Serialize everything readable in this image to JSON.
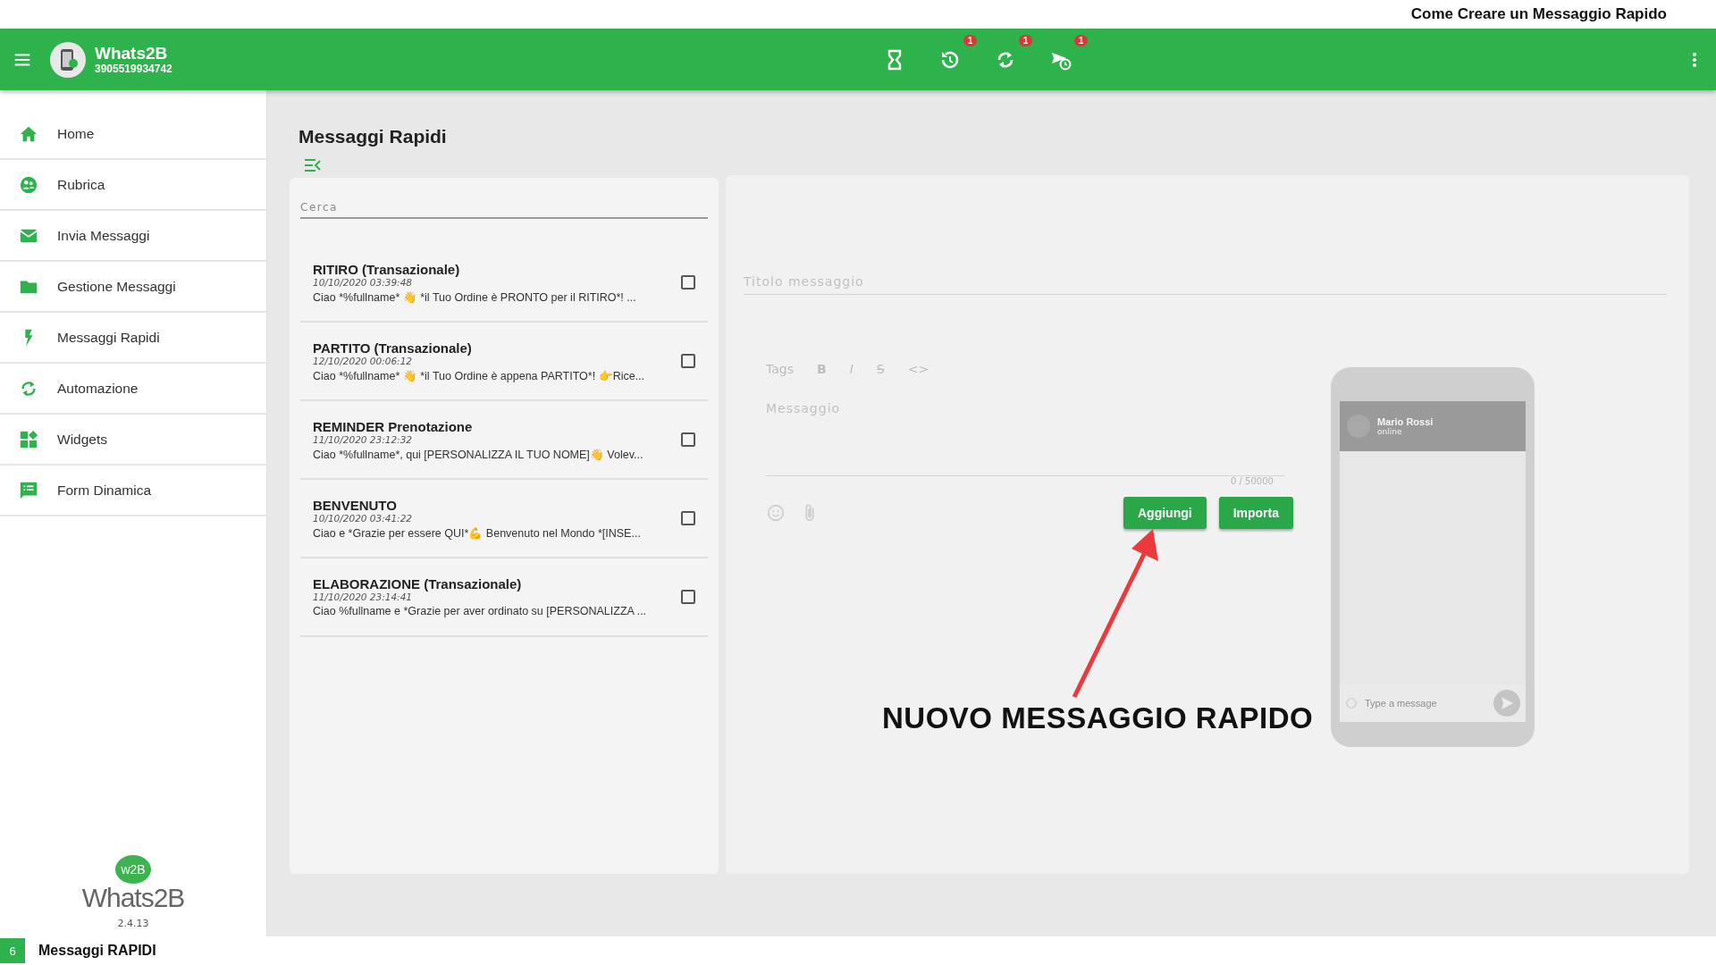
{
  "caption": {
    "title": "Come Creare un Messaggio Rapido"
  },
  "header": {
    "app_name": "Whats2B",
    "phone": "3905519934742",
    "actions": [
      {
        "kind": "hourglass"
      },
      {
        "kind": "history",
        "badge": "1"
      },
      {
        "kind": "sync",
        "badge": "1"
      },
      {
        "kind": "scheduled-send",
        "badge": "1"
      }
    ]
  },
  "sidebar": {
    "items": [
      {
        "label": "Home",
        "kind": "home"
      },
      {
        "label": "Rubrica",
        "kind": "contacts"
      },
      {
        "label": "Invia Messaggi",
        "kind": "mail"
      },
      {
        "label": "Gestione Messaggi",
        "kind": "folder"
      },
      {
        "label": "Messaggi Rapidi",
        "kind": "bolt"
      },
      {
        "label": "Automazione",
        "kind": "sync"
      },
      {
        "label": "Widgets",
        "kind": "widgets"
      },
      {
        "label": "Form Dinamica",
        "kind": "form"
      }
    ],
    "logo": {
      "mark": "w2B",
      "name": "Whats2B"
    },
    "version": "2.4.13"
  },
  "page": {
    "title": "Messaggi Rapidi",
    "search": {
      "placeholder": "Cerca"
    },
    "messages": [
      {
        "title": "RITIRO (Transazionale)",
        "date": "10/10/2020 03:39:48",
        "preview": "Ciao *%fullname* 👋 *il Tuo Ordine è PRONTO per il RITIRO*! ...",
        "checked": false
      },
      {
        "title": "PARTITO (Transazionale)",
        "date": "12/10/2020 00:06:12",
        "preview": "Ciao *%fullname* 👋 *il Tuo Ordine è appena PARTITO*! 👉Rice...",
        "checked": false
      },
      {
        "title": "REMINDER Prenotazione",
        "date": "11/10/2020 23:12:32",
        "preview": "Ciao *%fullname*, qui [PERSONALIZZA IL TUO NOME]👋 Volev...",
        "checked": false
      },
      {
        "title": "BENVENUTO",
        "date": "10/10/2020 03:41:22",
        "preview": "Ciao e *Grazie per essere QUI*💪 Benvenuto nel Mondo *[INSE...",
        "checked": false
      },
      {
        "title": "ELABORAZIONE (Transazionale)",
        "date": "11/10/2020 23:14:41",
        "preview": "Ciao %fullname e *Grazie per aver ordinato su [PERSONALIZZA ...",
        "checked": false
      }
    ]
  },
  "editor": {
    "title_field": {
      "placeholder": "Titolo messaggio"
    },
    "tags_label": "Tags",
    "format_buttons": [
      {
        "kind": "bold",
        "label": "B"
      },
      {
        "kind": "italic",
        "label": "I"
      },
      {
        "kind": "strike",
        "label": "S"
      },
      {
        "kind": "code",
        "label": "<>"
      }
    ],
    "message_field": {
      "placeholder": "Messaggio"
    },
    "counter": "0 / 50000",
    "buttons": [
      "Aggiungi",
      "Importa"
    ]
  },
  "preview": {
    "contact": "Mario Rossi",
    "status": "online",
    "input": {
      "placeholder": "Type a message"
    }
  },
  "annotation": {
    "text": "NUOVO MESSAGGIO RAPIDO"
  },
  "footer": {
    "step": "6",
    "label": "Messaggi RAPIDI"
  }
}
